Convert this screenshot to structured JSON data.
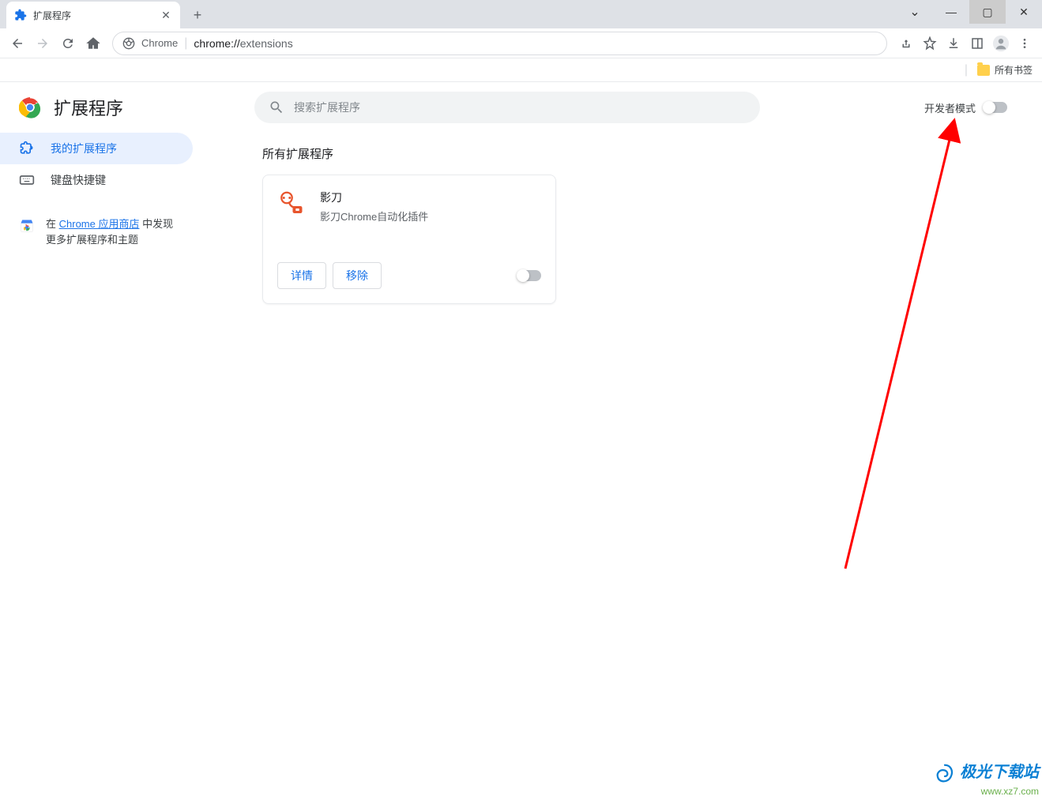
{
  "tab": {
    "title": "扩展程序"
  },
  "address": {
    "label": "Chrome",
    "scheme": "chrome://",
    "path": "extensions"
  },
  "bookmarks": {
    "all": "所有书签"
  },
  "header": {
    "title": "扩展程序",
    "search_placeholder": "搜索扩展程序",
    "dev_mode": "开发者模式"
  },
  "sidebar": {
    "items": [
      {
        "label": "我的扩展程序"
      },
      {
        "label": "键盘快捷键"
      }
    ],
    "promo_prefix": "在 ",
    "promo_link": "Chrome 应用商店",
    "promo_suffix": " 中发现更多扩展程序和主题"
  },
  "content": {
    "section_title": "所有扩展程序",
    "extensions": [
      {
        "name": "影刀",
        "desc": "影刀Chrome自动化插件",
        "details": "详情",
        "remove": "移除"
      }
    ]
  },
  "watermark": {
    "cn": "极光下载站",
    "url": "www.xz7.com"
  }
}
